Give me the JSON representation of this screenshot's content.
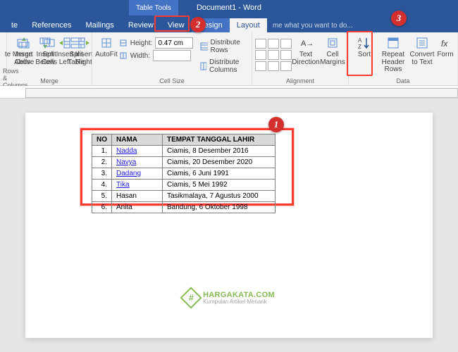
{
  "titlebar": {
    "doc": "Document1 - Word",
    "tabletools": "Table Tools"
  },
  "tabs": {
    "t0": "te",
    "t1": "References",
    "t2": "Mailings",
    "t3": "Review",
    "t4": "View",
    "t5": "Design",
    "t6": "Layout",
    "tellme": "me what you want to do..."
  },
  "groups": {
    "rowscols": {
      "label": "Rows & Columns",
      "b0": "te",
      "b1": "Insert Above",
      "b2": "Insert Below",
      "b3": "Insert Left",
      "b4": "Insert Right"
    },
    "merge": {
      "label": "Merge",
      "b1": "Merge Cells",
      "b2": "Split Cells",
      "b3": "Split Table"
    },
    "cellsize": {
      "label": "Cell Size",
      "autofit": "AutoFit",
      "height_lbl": "Height:",
      "width_lbl": "Width:",
      "height_val": "0.47 cm",
      "width_val": "",
      "distrows": "Distribute Rows",
      "distcols": "Distribute Columns"
    },
    "alignment": {
      "label": "Alignment",
      "textdir": "Text Direction",
      "cellmarg": "Cell Margins"
    },
    "data": {
      "label": "Data",
      "sort": "Sort",
      "repeat": "Repeat Header Rows",
      "convert": "Convert to Text",
      "form": "Form"
    }
  },
  "tbl": {
    "h1": "NO",
    "h2": "NAMA",
    "h3": "TEMPAT TANGGAL LAHIR",
    "rows": [
      {
        "no": "1.",
        "nm": "Nadda",
        "tl": "Ciamis, 8 Desember 2016",
        "link": true
      },
      {
        "no": "2.",
        "nm": "Navya",
        "tl": "Ciamis, 20 Desember 2020",
        "link": true
      },
      {
        "no": "3.",
        "nm": "Dadang",
        "tl": "Ciamis, 6 Juni 1991",
        "link": true
      },
      {
        "no": "4.",
        "nm": "Tika",
        "tl": "Ciamis, 5 Mei 1992",
        "link": true
      },
      {
        "no": "5.",
        "nm": "Hasan",
        "tl": "Tasikmalaya, 7 Agustus 2000",
        "link": false
      },
      {
        "no": "6.",
        "nm": "Anita",
        "tl": "Bandung, 6 Oktober 1998",
        "link": false
      }
    ]
  },
  "markers": {
    "m1": "1",
    "m2": "2",
    "m3": "3"
  },
  "wm": {
    "t1": "HARGAKATA.COM",
    "t2": "Kumpulan Artikel Menarik",
    "hash": "#"
  }
}
